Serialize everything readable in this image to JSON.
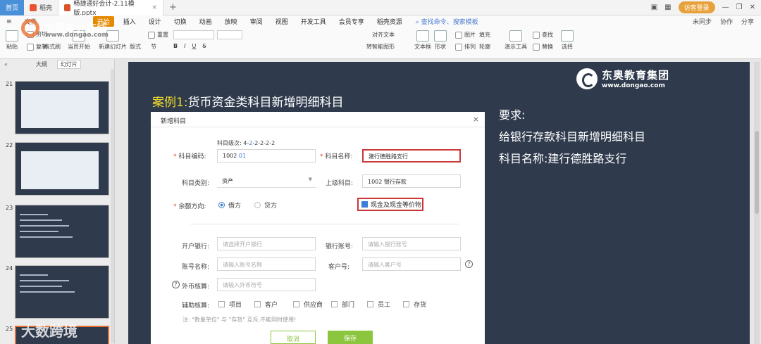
{
  "tabs": {
    "home": "首页",
    "doc": "稻壳",
    "active_file": "畅捷通好会计-2.11模版.pptx",
    "plus": "+",
    "close": "×"
  },
  "window": {
    "login": "访客登录"
  },
  "menu": {
    "file": "文件",
    "start": "开始",
    "items": [
      "插入",
      "设计",
      "切换",
      "动画",
      "放映",
      "审阅",
      "视图",
      "开发工具",
      "会员专享",
      "稻壳资源"
    ],
    "search": "查找命令、搜索模板",
    "right": [
      "未同步",
      "协作",
      "分享"
    ]
  },
  "ribbon": {
    "paste": "粘贴",
    "cut": "剪切",
    "copy": "复制",
    "format_painter": "格式刷",
    "from_start": "当页开始",
    "new_slide": "新建幻灯片",
    "layout": "版式",
    "section": "节",
    "reset": "重置",
    "textbox": "文本框",
    "shape": "形状",
    "arrange": "排列",
    "outline": "轮廓",
    "picture": "图片",
    "fill": "填充",
    "find": "查找",
    "replace": "替换",
    "select": "选择",
    "presenter": "演示工具",
    "align_text": "对齐文本",
    "convert_smartart": "转智能图形",
    "bold": "B",
    "italic": "I",
    "underline": "U",
    "strike": "S"
  },
  "left_panel": {
    "outline_tab": "大纲",
    "slides_tab": "幻灯片",
    "collapse": "«",
    "slide_numbers": [
      "21",
      "22",
      "23",
      "24",
      "25"
    ]
  },
  "slide": {
    "title_highlight": "案例1:",
    "title_rest": "货币资金类科目新增明细科目",
    "brand_name": "东奥教育集团",
    "brand_url": "www.dongao.com",
    "requirements": [
      "要求:",
      "给银行存款科目新增明细科目",
      "科目名称:建行德胜路支行"
    ]
  },
  "dialog": {
    "title": "新增科目",
    "close": "×",
    "level_hint_prefix": "科目级次: 4-",
    "level_hint_blue": "2",
    "level_hint_suffix": "-2-2-2-2",
    "code_label": "科目编码:",
    "code_value": "1002",
    "code_value_blue": "01",
    "name_label": "科目名称:",
    "name_value": "建行德胜路支行",
    "category_label": "科目类别:",
    "category_value": "资产",
    "parent_label": "上级科目:",
    "parent_value": "1002 银行存款",
    "balance_label": "余额方向:",
    "debit": "借方",
    "credit": "贷方",
    "cash_equiv": "现金及现金等价物",
    "bank_label": "开户银行:",
    "bank_ph": "请选择开户银行",
    "account_no_label": "银行账号:",
    "account_no_ph": "请输入银行账号",
    "account_name_label": "账号名称:",
    "account_name_ph": "请输入账号名称",
    "customer_no_label": "客户号:",
    "customer_no_ph": "请输入客户号",
    "fx_label": "外币核算:",
    "fx_ph": "请输入外币符号",
    "aux_label": "辅助核算:",
    "aux_items": [
      "项目",
      "客户",
      "供应商",
      "部门",
      "员工",
      "存货"
    ],
    "note": "注: \"数量单位\" 与 \"存货\" 互斥,不能同时使用!",
    "cancel": "取消",
    "save": "保存",
    "help": "?",
    "star": "*"
  },
  "watermarks": {
    "top": "东奥会计在线",
    "url": "www.dongao.com",
    "bottom": "大数跨境"
  }
}
